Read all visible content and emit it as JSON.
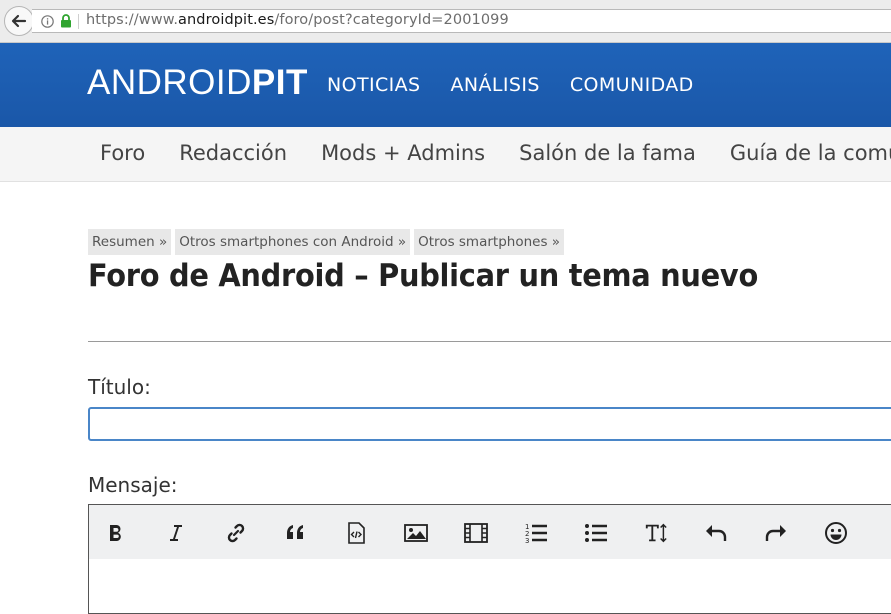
{
  "browser": {
    "url_scheme": "https://www.",
    "url_host": "androidpit.es",
    "url_path": "/foro/post?categoryId=2001099"
  },
  "header": {
    "logo_part1": "ANDROID",
    "logo_part2": "PIT",
    "nav": [
      "NOTICIAS",
      "ANÁLISIS",
      "COMUNIDAD"
    ]
  },
  "subnav": {
    "items": [
      "Foro",
      "Redacción",
      "Mods + Admins",
      "Salón de la fama",
      "Guía de la comunidad"
    ]
  },
  "breadcrumb": [
    "Resumen »",
    "Otros smartphones con Android »",
    "Otros smartphones »"
  ],
  "page": {
    "title": "Foro de Android – Publicar un tema nuevo",
    "titulo_label": "Título:",
    "titulo_value": "",
    "mensaje_label": "Mensaje:"
  },
  "toolbar": {
    "icons": [
      "bold-icon",
      "italic-icon",
      "link-icon",
      "quote-icon",
      "code-icon",
      "image-icon",
      "video-icon",
      "numbered-list-icon",
      "bullet-list-icon",
      "text-size-icon",
      "undo-icon",
      "redo-icon",
      "emoji-icon"
    ]
  },
  "colors": {
    "header_blue": "#1a5aac",
    "focus_blue": "#4a86c8",
    "toolbar_bg": "#eff0f1"
  }
}
